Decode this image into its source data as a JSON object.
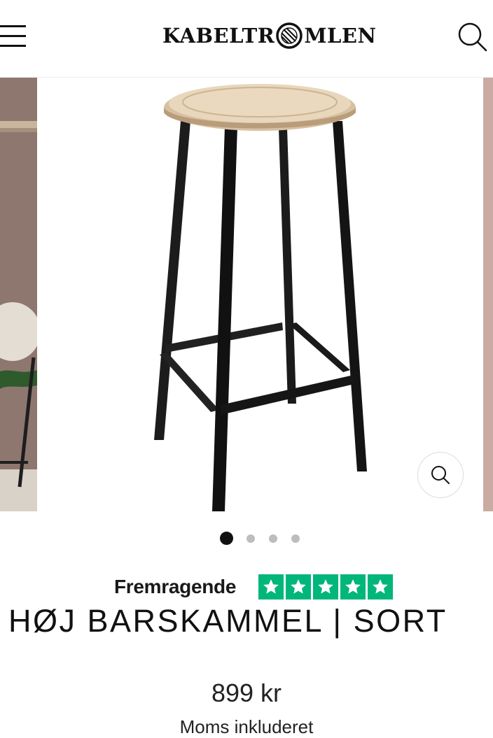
{
  "header": {
    "logo_left": "KABELTR",
    "logo_right": "MLEN",
    "logo_full": "KABELTROMLEN"
  },
  "gallery": {
    "active_index": 0,
    "slide_count": 4
  },
  "rating": {
    "label": "Fremragende",
    "stars": 5,
    "star_color": "#00b67a"
  },
  "product": {
    "title": "HØJ BARSKAMMEL | SORT",
    "price": "899 kr",
    "tax_note": "Moms inkluderet"
  },
  "colors": {
    "accent_green": "#00b67a",
    "text": "#111111"
  }
}
